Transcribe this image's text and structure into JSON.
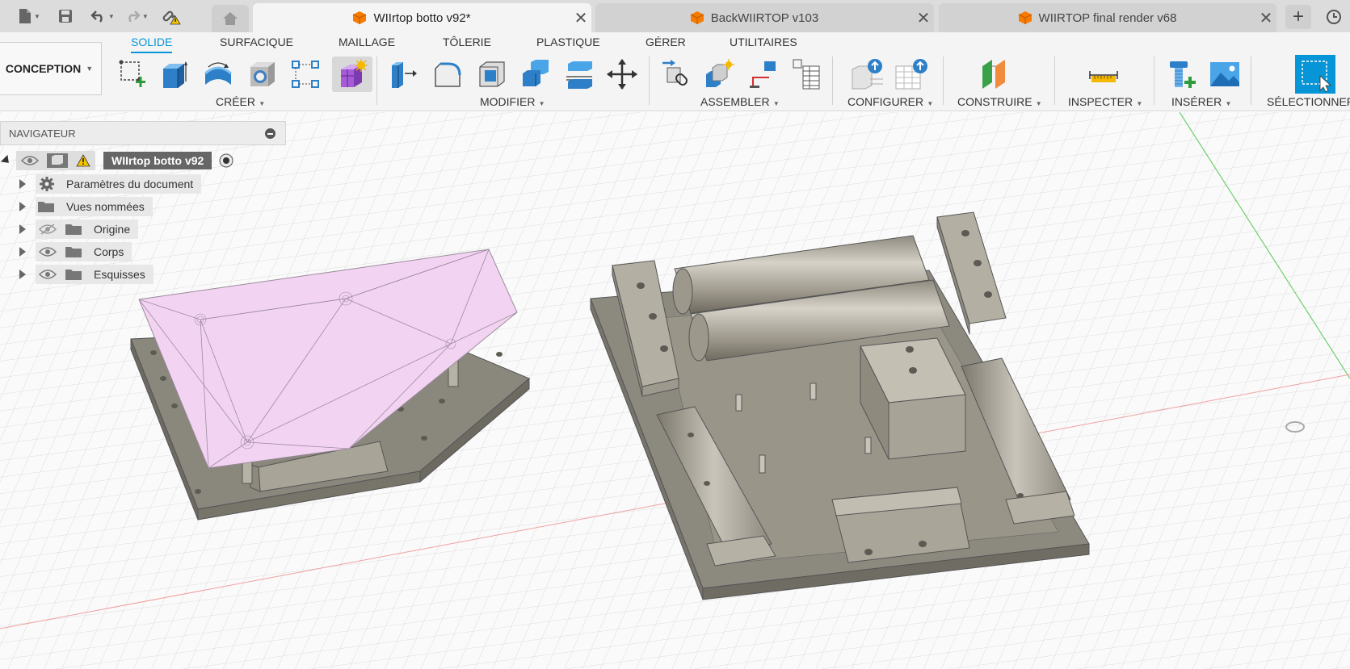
{
  "tabs": {
    "items": [
      {
        "label": "WIIrtop botto v92*",
        "active": true
      },
      {
        "label": "BackWIIRTOP v103",
        "active": false
      },
      {
        "label": "WIIRTOP final render v68",
        "active": false
      }
    ],
    "new_tab_icon": "plus-icon",
    "accent": "#f57c00"
  },
  "ribbon": {
    "workspace": "CONCEPTION",
    "tabs": [
      "SOLIDE",
      "SURFACIQUE",
      "MAILLAGE",
      "TÔLERIE",
      "PLASTIQUE",
      "GÉRER",
      "UTILITAIRES"
    ],
    "active_tab": "SOLIDE",
    "groups": [
      "CRÉER",
      "MODIFIER",
      "ASSEMBLER",
      "CONFIGURER",
      "CONSTRUIRE",
      "INSPECTER",
      "INSÉRER",
      "SÉLECTIONNER"
    ],
    "accent": "#0696d7"
  },
  "navigator": {
    "title": "NAVIGATEUR",
    "root": "WIIrtop botto v92",
    "items": [
      "Paramètres du document",
      "Vues nommées",
      "Origine",
      "Corps",
      "Esquisses"
    ]
  }
}
